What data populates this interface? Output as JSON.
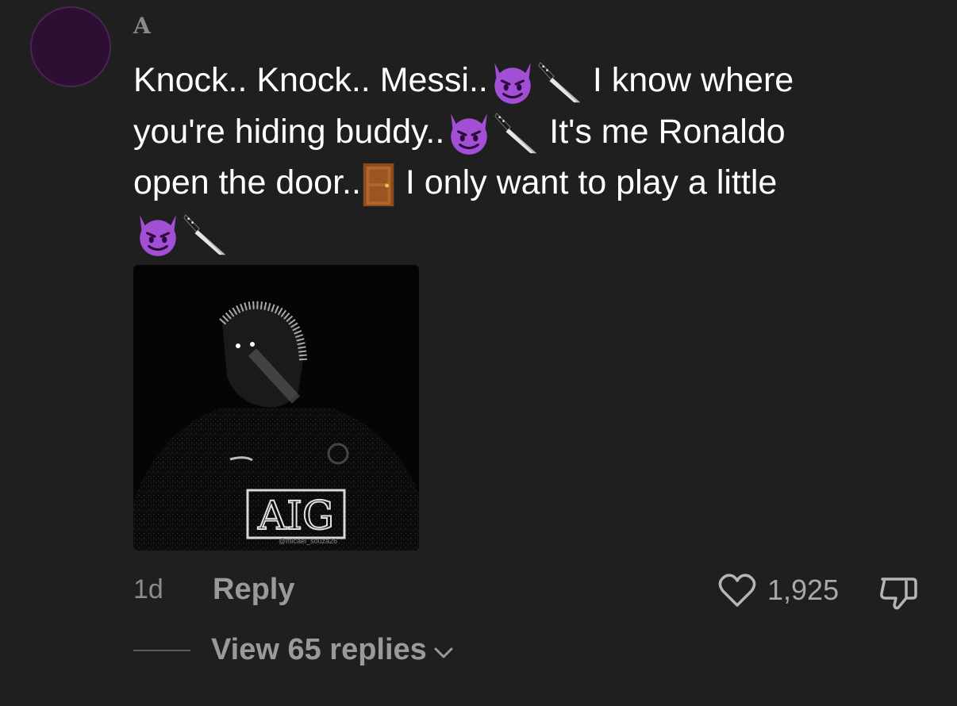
{
  "comment": {
    "username": "A",
    "text_line1_a": "Knock.. Knock.. Messi..",
    "text_line1_b": " I know where",
    "text_line2_a": "you're hiding buddy..",
    "text_line2_b": " It's me Ronaldo",
    "text_line3_a": "open the door..",
    "text_line3_b": " I only want to play a little",
    "media_text": "AIG",
    "media_watermark": "@micael_souza26",
    "time": "1d",
    "reply_label": "Reply",
    "like_count": "1,925",
    "view_replies_label": "View 65 replies"
  },
  "icons": {
    "devil": "smiling-face-with-horns-icon",
    "knife": "knife-icon",
    "door": "door-icon",
    "heart": "heart-outline-icon",
    "dislike": "thumbs-down-icon",
    "chevron": "chevron-down-icon"
  },
  "colors": {
    "background": "#1f1f1f",
    "avatar": "#2c0f33",
    "muted_text": "#9a9a9a"
  }
}
